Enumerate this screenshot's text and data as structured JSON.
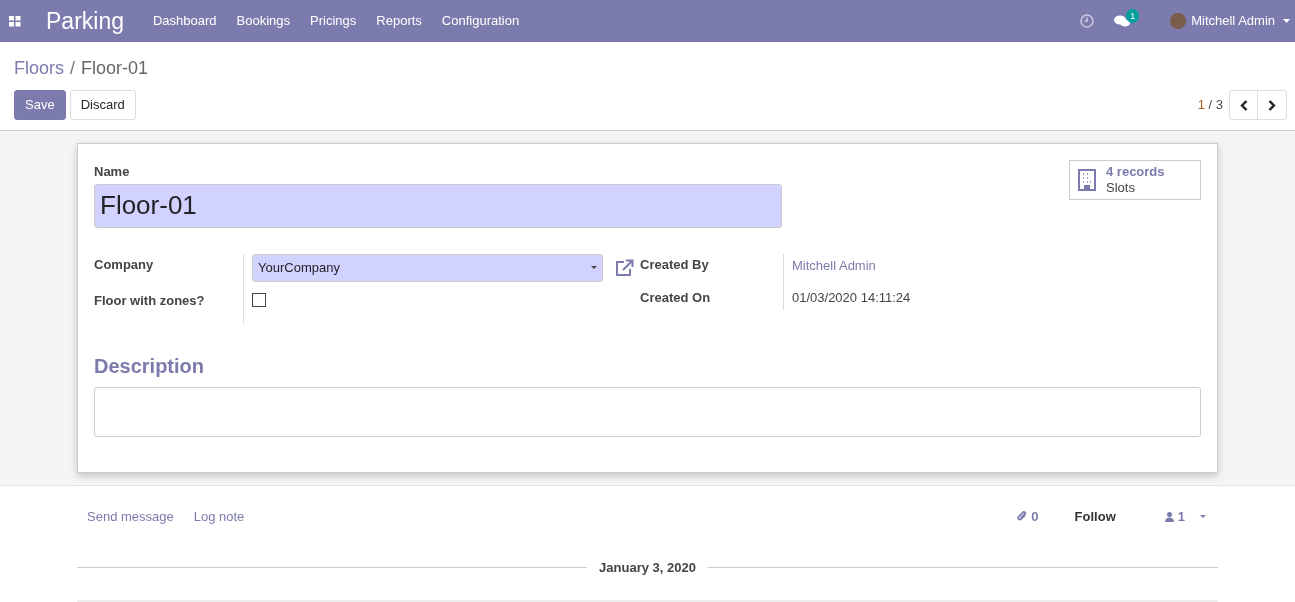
{
  "navbar": {
    "app_title": "Parking",
    "menu": [
      "Dashboard",
      "Bookings",
      "Pricings",
      "Reports",
      "Configuration"
    ],
    "message_count": "1",
    "user": "Mitchell Admin"
  },
  "breadcrumb": {
    "parent": "Floors",
    "separator": "/",
    "current": "Floor-01"
  },
  "buttons": [
    {
      "label": "Save",
      "kind": "primary"
    },
    {
      "label": "Discard",
      "kind": "secondary"
    }
  ],
  "pager": {
    "current": "1",
    "total": "/ 3"
  },
  "form": {
    "name_label": "Name",
    "name_value": "Floor-01",
    "smart_button": {
      "count": "4 records",
      "label": "Slots"
    },
    "left_fields": [
      {
        "kind": "select",
        "label": "Company",
        "value": "YourCompany"
      },
      {
        "kind": "checkbox",
        "label": "Floor with zones?",
        "checked": false
      }
    ],
    "right_fields": [
      {
        "kind": "link",
        "label": "Created By",
        "value": "Mitchell Admin"
      },
      {
        "kind": "text",
        "label": "Created On",
        "value": "01/03/2020 14:11:24"
      }
    ],
    "description_label": "Description"
  },
  "chatter": {
    "send_message": "Send message",
    "log_note": "Log note",
    "attachments": "0",
    "follow": "Follow",
    "followers": "1",
    "date": "January 3, 2020"
  }
}
